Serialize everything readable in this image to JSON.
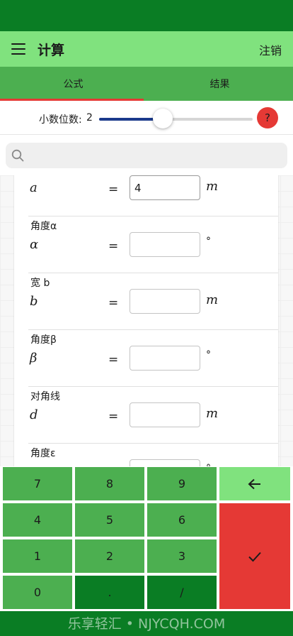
{
  "app": {
    "title": "计算",
    "logout_label": "注销"
  },
  "tabs": [
    {
      "label": "公式",
      "active": true
    },
    {
      "label": "结果",
      "active": false
    }
  ],
  "decimals": {
    "label": "小数位数:",
    "value": "2",
    "slider_fraction": 0.41
  },
  "help": {
    "label": "?"
  },
  "search": {
    "placeholder": "",
    "value": ""
  },
  "fields": [
    {
      "label": "",
      "symbol": "a",
      "equals": "=",
      "value": "4",
      "unit": "m"
    },
    {
      "label": "角度α",
      "symbol": "α",
      "equals": "=",
      "value": "",
      "unit": "°"
    },
    {
      "label": "宽 b",
      "symbol": "b",
      "equals": "=",
      "value": "",
      "unit": "m"
    },
    {
      "label": "角度β",
      "symbol": "β",
      "equals": "=",
      "value": "",
      "unit": "°"
    },
    {
      "label": "对角线",
      "symbol": "d",
      "equals": "=",
      "value": "",
      "unit": "m"
    },
    {
      "label": "角度ε",
      "symbol": "",
      "equals": "",
      "value": "",
      "unit": "°"
    }
  ],
  "keypad": {
    "k7": "7",
    "k8": "8",
    "k9": "9",
    "k4": "4",
    "k5": "5",
    "k6": "6",
    "k1": "1",
    "k2": "2",
    "k3": "3",
    "k0": "0",
    "dot": ".",
    "slash": "/",
    "backspace_icon": "arrow-left-icon",
    "enter_icon": "checkmark-icon"
  },
  "watermark": "乐享轻汇 • NJYCQH.COM",
  "colors": {
    "status_bar": "#0a7d24",
    "app_bar": "#80e27e",
    "tab_bar": "#4caf50",
    "accent_red": "#e53935",
    "slider": "#1b3a8c"
  }
}
